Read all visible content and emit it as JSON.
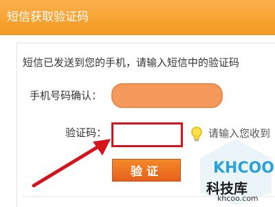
{
  "header": {
    "title": "短信获取验证码"
  },
  "message": "短信已发送到您的手机，请输入短信中的验证码",
  "form": {
    "phone_label": "手机号码确认：",
    "code_label": "验证码：",
    "code_value": "",
    "hint": "请输入您收到",
    "verify_button": "验证"
  },
  "watermark": {
    "logo": "KHCOO",
    "name": "科技库",
    "url": "khcoo.com"
  },
  "colors": {
    "header": "#f39a22",
    "phone_field": "#f59a5b",
    "code_border": "#d6121c",
    "button": "#e6601c",
    "arrow": "#d6121c"
  },
  "icons": [
    "lightbulb-icon",
    "red-arrow-icon"
  ]
}
